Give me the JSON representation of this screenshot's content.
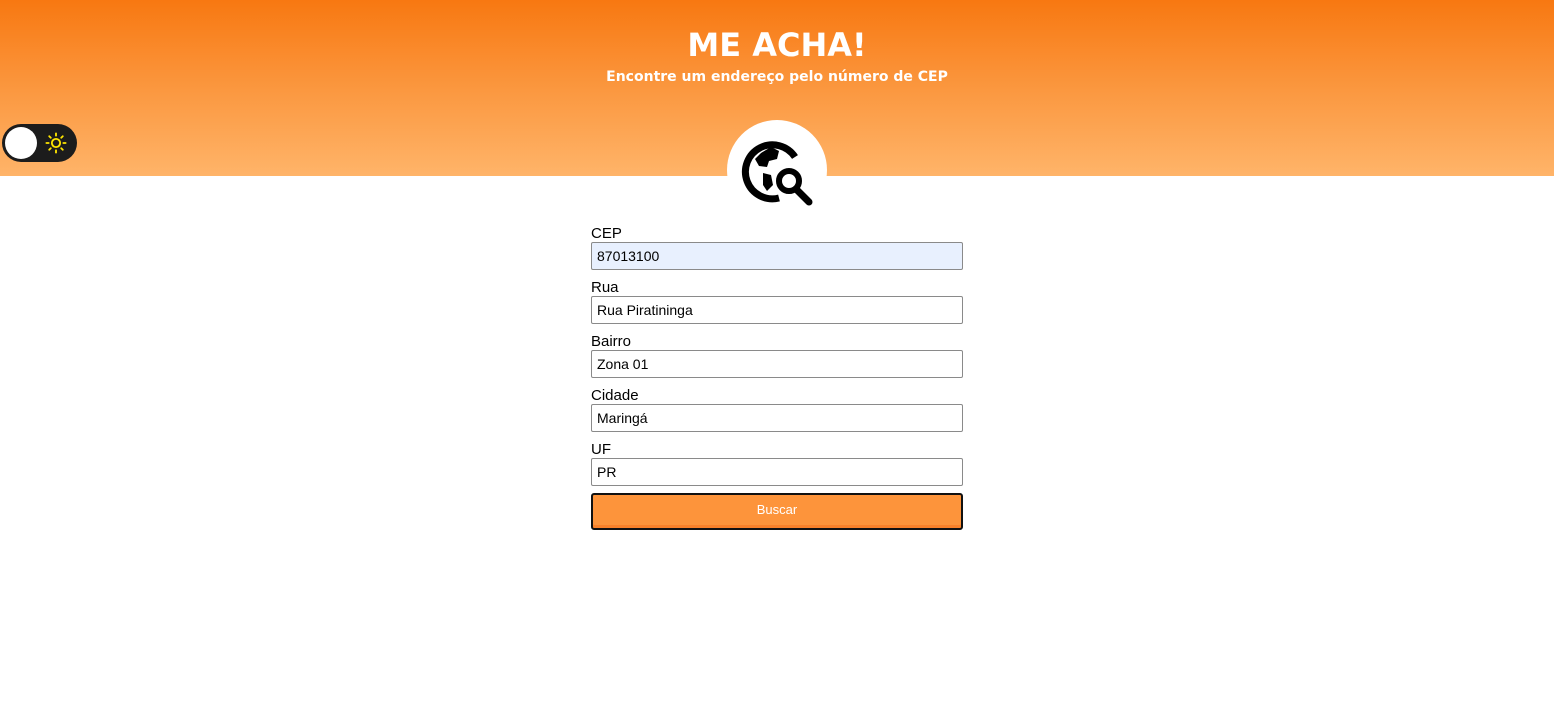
{
  "header": {
    "title": "ME ACHA!",
    "subtitle": "Encontre um endereço pelo número de CEP",
    "gradient_colors": [
      "#f87811",
      "#ffb469"
    ]
  },
  "theme_toggle": {
    "state": "light",
    "icon": "sun-icon",
    "icon_color": "#ffe600"
  },
  "logo": {
    "icon": "globe-search-icon"
  },
  "form": {
    "fields": [
      {
        "label": "CEP",
        "value": "87013100"
      },
      {
        "label": "Rua",
        "value": "Rua Piratininga"
      },
      {
        "label": "Bairro",
        "value": "Zona 01"
      },
      {
        "label": "Cidade",
        "value": "Maringá"
      },
      {
        "label": "UF",
        "value": "PR"
      }
    ],
    "submit_label": "Buscar",
    "accent_color": "#fd943b"
  }
}
